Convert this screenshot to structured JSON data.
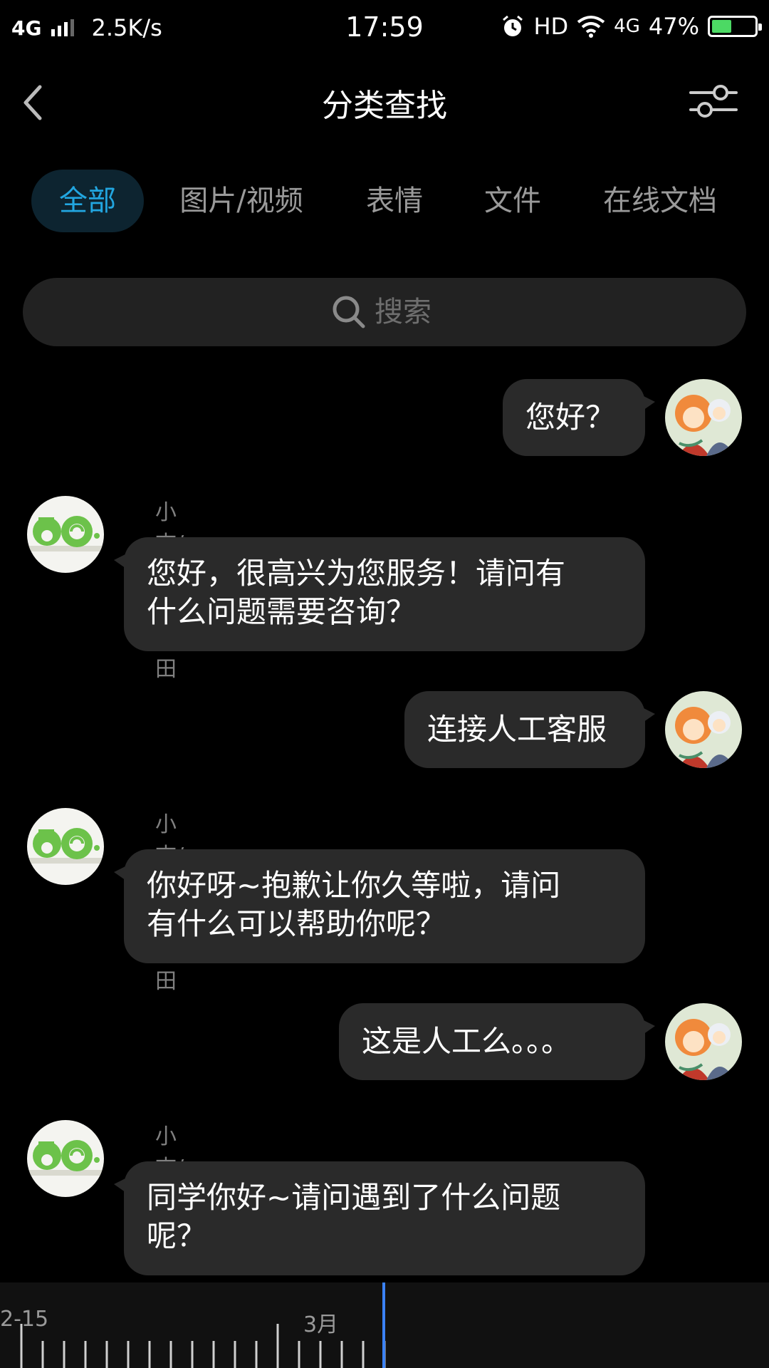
{
  "status_bar": {
    "network": "4G",
    "speed": "2.5K/s",
    "time": "17:59",
    "hd": "HD",
    "network2": "4G",
    "battery": "47%",
    "battery_level": 0.47
  },
  "nav": {
    "title": "分类查找",
    "back_icon": "chevron-left-icon",
    "filter_icon": "sliders-icon"
  },
  "tabs": [
    {
      "label": "全部",
      "active": true
    },
    {
      "label": "图片/视频",
      "active": false
    },
    {
      "label": "表情",
      "active": false
    },
    {
      "label": "文件",
      "active": false
    },
    {
      "label": "在线文档",
      "active": false
    }
  ],
  "search": {
    "placeholder": "搜索",
    "icon": "search-icon"
  },
  "messages": [
    {
      "side": "right",
      "text": "您好？"
    },
    {
      "side": "left",
      "sender": "小志/广州百田",
      "lines": [
        "您好，很高兴为您服务！请问有",
        "什么问题需要咨询？"
      ]
    },
    {
      "side": "right",
      "text": "连接人工客服"
    },
    {
      "side": "left",
      "sender": "小志/广州百田",
      "lines": [
        "你好呀~抱歉让你久等啦，请问",
        "有什么可以帮助你呢？"
      ]
    },
    {
      "side": "right",
      "text": "这是人工么。。。"
    },
    {
      "side": "left",
      "sender": "小志/广州百田",
      "lines": [
        "同学你好~请问遇到了什么问题",
        "呢？"
      ]
    }
  ],
  "timeline": {
    "labels": [
      "2-15",
      "3月"
    ]
  },
  "colors": {
    "accent": "#22a6e0",
    "bubble": "#2a2a2a",
    "timeline_cursor": "#3b82f6",
    "battery_fill": "#4cd964"
  }
}
